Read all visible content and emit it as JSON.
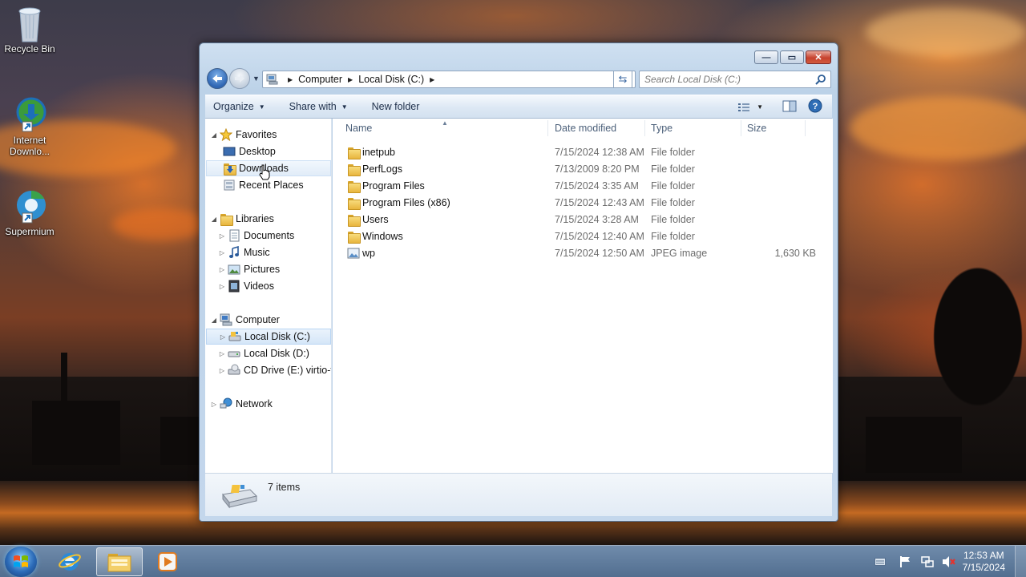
{
  "desktop": {
    "icons": [
      {
        "label": "Recycle Bin"
      },
      {
        "label": "Internet Downlo..."
      },
      {
        "label": "Supermium"
      }
    ]
  },
  "window": {
    "address": {
      "crumbs": [
        "Computer",
        "Local Disk (C:)"
      ]
    },
    "search": {
      "placeholder": "Search Local Disk (C:)"
    },
    "toolbar": {
      "organize_label": "Organize",
      "share_label": "Share with",
      "new_folder_label": "New folder"
    },
    "nav": {
      "favorites": {
        "label": "Favorites",
        "items": [
          {
            "label": "Desktop"
          },
          {
            "label": "Downloads"
          },
          {
            "label": "Recent Places"
          }
        ]
      },
      "libraries": {
        "label": "Libraries",
        "items": [
          {
            "label": "Documents"
          },
          {
            "label": "Music"
          },
          {
            "label": "Pictures"
          },
          {
            "label": "Videos"
          }
        ]
      },
      "computer": {
        "label": "Computer",
        "items": [
          {
            "label": "Local Disk (C:)"
          },
          {
            "label": "Local Disk (D:)"
          },
          {
            "label": "CD Drive (E:) virtio-v"
          }
        ]
      },
      "network": {
        "label": "Network"
      }
    },
    "columns": {
      "name": "Name",
      "date": "Date modified",
      "type": "Type",
      "size": "Size"
    },
    "files": [
      {
        "name": "inetpub",
        "date": "7/15/2024 12:38 AM",
        "type": "File folder",
        "size": "",
        "icon": "folder-icon"
      },
      {
        "name": "PerfLogs",
        "date": "7/13/2009 8:20 PM",
        "type": "File folder",
        "size": "",
        "icon": "folder-icon"
      },
      {
        "name": "Program Files",
        "date": "7/15/2024 3:35 AM",
        "type": "File folder",
        "size": "",
        "icon": "folder-icon"
      },
      {
        "name": "Program Files (x86)",
        "date": "7/15/2024 12:43 AM",
        "type": "File folder",
        "size": "",
        "icon": "folder-icon"
      },
      {
        "name": "Users",
        "date": "7/15/2024 3:28 AM",
        "type": "File folder",
        "size": "",
        "icon": "folder-icon"
      },
      {
        "name": "Windows",
        "date": "7/15/2024 12:40 AM",
        "type": "File folder",
        "size": "",
        "icon": "folder-icon"
      },
      {
        "name": "wp",
        "date": "7/15/2024 12:50 AM",
        "type": "JPEG image",
        "size": "1,630 KB",
        "icon": "image-file-icon"
      }
    ],
    "details": {
      "count": "7 items"
    }
  },
  "taskbar": {
    "clock": {
      "time": "12:53 AM",
      "date": "7/15/2024"
    }
  },
  "colors": {
    "window_frame": "#c4d7ec",
    "taskbar": "#6f8fb3",
    "selection": "#d5e6f8"
  }
}
